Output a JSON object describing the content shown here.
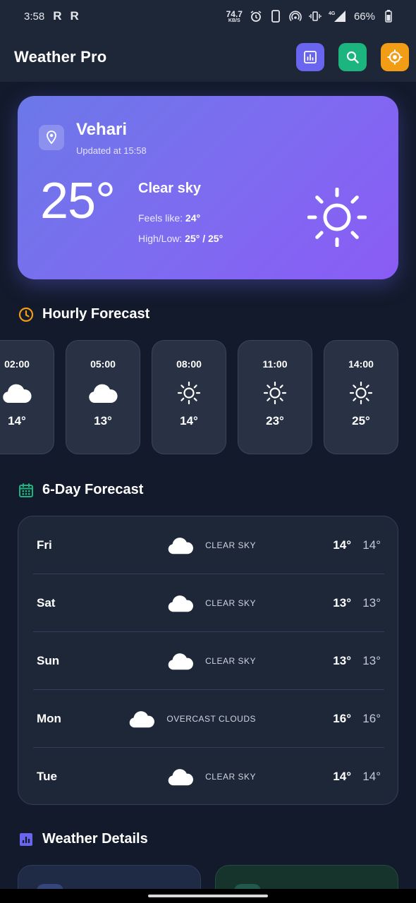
{
  "status_bar": {
    "time": "3:58",
    "app_badge_1": "R",
    "app_badge_2": "R",
    "net_speed": "74.7",
    "net_speed_unit": "KB/S",
    "net_type": "4G",
    "battery": "66%"
  },
  "app_bar": {
    "title": "Weather Pro",
    "actions": [
      {
        "name": "stats",
        "icon": "chart-icon",
        "color": "#6a65ee"
      },
      {
        "name": "search",
        "icon": "search-icon",
        "color": "#1db57f"
      },
      {
        "name": "location",
        "icon": "crosshair-icon",
        "color": "#f39c16"
      }
    ]
  },
  "current": {
    "city": "Vehari",
    "updated": "Updated at 15:58",
    "temperature": "25°",
    "condition": "Clear sky",
    "feels_label": "Feels like: ",
    "feels_value": "24°",
    "hilo_label": "High/Low: ",
    "hilo_value": "25° / 25°",
    "icon": "sun-icon"
  },
  "hourly": {
    "title": "Hourly Forecast",
    "items": [
      {
        "time": "02:00",
        "icon": "cloud-icon",
        "temp": "14°"
      },
      {
        "time": "05:00",
        "icon": "cloud-icon",
        "temp": "13°"
      },
      {
        "time": "08:00",
        "icon": "sun-icon",
        "temp": "14°"
      },
      {
        "time": "11:00",
        "icon": "sun-icon",
        "temp": "23°"
      },
      {
        "time": "14:00",
        "icon": "sun-icon",
        "temp": "25°"
      }
    ]
  },
  "daily": {
    "title": "6-Day Forecast",
    "items": [
      {
        "day": "Fri",
        "desc": "CLEAR SKY",
        "hi": "14°",
        "lo": "14°"
      },
      {
        "day": "Sat",
        "desc": "CLEAR SKY",
        "hi": "13°",
        "lo": "13°"
      },
      {
        "day": "Sun",
        "desc": "CLEAR SKY",
        "hi": "13°",
        "lo": "13°"
      },
      {
        "day": "Mon",
        "desc": "OVERCAST CLOUDS",
        "hi": "16°",
        "lo": "16°"
      },
      {
        "day": "Tue",
        "desc": "CLEAR SKY",
        "hi": "14°",
        "lo": "14°"
      }
    ]
  },
  "details": {
    "title": "Weather Details"
  },
  "colors": {
    "background": "#121a2b",
    "accent_orange": "#f39c16",
    "accent_green": "#1db57f",
    "accent_purple": "#6a65ee"
  }
}
